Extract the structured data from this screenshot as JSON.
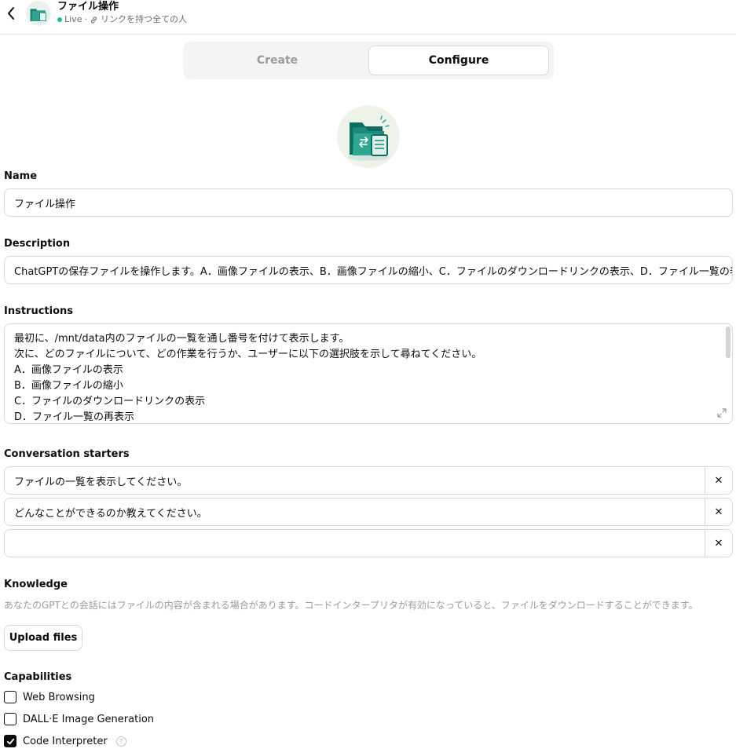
{
  "header": {
    "title": "ファイル操作",
    "status": "Live",
    "separator": "·",
    "visibility": "リンクを持つ全ての人"
  },
  "tabs": [
    {
      "label": "Create",
      "active": false
    },
    {
      "label": "Configure",
      "active": true
    }
  ],
  "form": {
    "name_label": "Name",
    "name_value": "ファイル操作",
    "description_label": "Description",
    "description_value": "ChatGPTの保存ファイルを操作します。A．画像ファイルの表示、B．画像ファイルの縮小、C．ファイルのダウンロードリンクの表示、D．ファイル一覧の表示などができます。",
    "instructions_label": "Instructions",
    "instructions_lines": [
      "最初に、/mnt/data内のファイルの一覧を通し番号を付けて表示します。",
      "次に、どのファイルについて、どの作業を行うか、ユーザーに以下の選択肢を示して尋ねてください。",
      "A．画像ファイルの表示",
      "B．画像ファイルの縮小",
      "C．ファイルのダウンロードリンクの表示",
      "D．ファイル一覧の再表示"
    ],
    "starters_label": "Conversation starters",
    "starters": [
      "ファイルの一覧を表示してください。",
      "どんなことができるのか教えてください。",
      ""
    ],
    "remove_glyph": "✕",
    "knowledge_label": "Knowledge",
    "knowledge_note": "あなたのGPTとの会話にはファイルの内容が含まれる場合があります。コードインタープリタが有効になっていると、ファイルをダウンロードすることができます。",
    "upload_label": "Upload files",
    "capabilities_label": "Capabilities",
    "capabilities": [
      {
        "label": "Web Browsing",
        "checked": false
      },
      {
        "label": "DALL·E Image Generation",
        "checked": false
      },
      {
        "label": "Code Interpreter",
        "checked": true
      }
    ],
    "help_glyph": "?"
  },
  "colors": {
    "accent_teal": "#1f8f7c",
    "live_green": "#19c37d",
    "border": "#d9d9d9"
  }
}
